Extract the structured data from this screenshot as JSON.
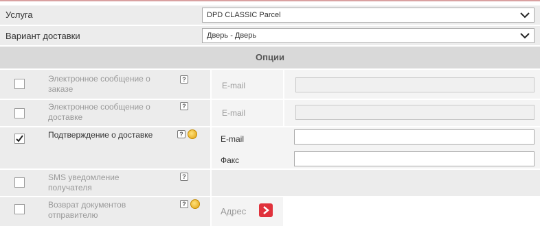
{
  "service": {
    "label": "Услуга",
    "value": "DPD CLASSIC Parcel"
  },
  "delivery": {
    "label": "Вариант доставки",
    "value": "Дверь - Дверь"
  },
  "options_header": "Опции",
  "options": [
    {
      "label": "Электронное сообщение о заказе",
      "checked": false,
      "enabled": false,
      "fields": [
        {
          "label": "E-mail",
          "value": ""
        }
      ]
    },
    {
      "label": "Электронное сообщение о доставке",
      "checked": false,
      "enabled": false,
      "fields": [
        {
          "label": "E-mail",
          "value": ""
        }
      ]
    },
    {
      "label": "Подтверждение о доставке",
      "checked": true,
      "enabled": true,
      "paid": true,
      "fields": [
        {
          "label": "E-mail",
          "value": ""
        },
        {
          "label": "Факс",
          "value": ""
        }
      ]
    },
    {
      "label": "SMS уведомление получателя",
      "checked": false,
      "enabled": false,
      "fields": []
    },
    {
      "label": "Возврат документов отправителю",
      "checked": false,
      "enabled": false,
      "paid": true,
      "address_label": "Адрес"
    }
  ],
  "help_glyph": "?",
  "icons": {
    "help": "help-icon",
    "paid": "coin-icon",
    "check": "checkmark-icon",
    "arrow": "chevron-down-icon",
    "go": "arrow-right-icon"
  },
  "colors": {
    "accent_red": "#e0323c",
    "header_bg": "#d9d9d9",
    "row_bg": "#ececec"
  }
}
